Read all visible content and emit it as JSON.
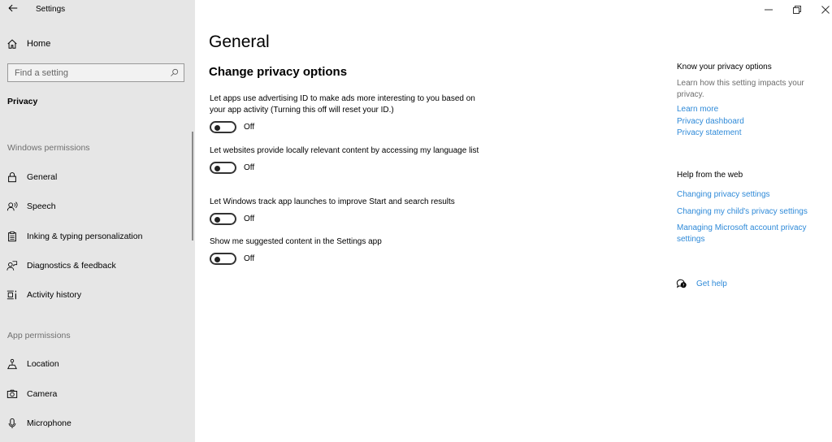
{
  "window": {
    "title": "Settings",
    "controls": {
      "minimize": "minimize-icon",
      "restore": "restore-icon",
      "close": "close-icon"
    }
  },
  "sidebar": {
    "home_label": "Home",
    "search_placeholder": "Find a setting",
    "current_section": "Privacy",
    "groups": [
      {
        "heading": "Windows permissions",
        "items": [
          {
            "label": "General",
            "icon": "lock-icon"
          },
          {
            "label": "Speech",
            "icon": "speech-icon"
          },
          {
            "label": "Inking & typing personalization",
            "icon": "clipboard-icon"
          },
          {
            "label": "Diagnostics & feedback",
            "icon": "feedback-icon"
          },
          {
            "label": "Activity history",
            "icon": "timeline-icon"
          }
        ]
      },
      {
        "heading": "App permissions",
        "items": [
          {
            "label": "Location",
            "icon": "location-icon"
          },
          {
            "label": "Camera",
            "icon": "camera-icon"
          },
          {
            "label": "Microphone",
            "icon": "microphone-icon"
          }
        ]
      }
    ]
  },
  "main": {
    "title": "General",
    "subtitle": "Change privacy options",
    "options": [
      {
        "description": "Let apps use advertising ID to make ads more interesting to you based on your app activity (Turning this off will reset your ID.)",
        "state": "Off",
        "on": false
      },
      {
        "description": "Let websites provide locally relevant content by accessing my language list",
        "state": "Off",
        "on": false
      },
      {
        "description": "Let Windows track app launches to improve Start and search results",
        "state": "Off",
        "on": false
      },
      {
        "description": "Show me suggested content in the Settings app",
        "state": "Off",
        "on": false
      }
    ]
  },
  "aside": {
    "know": {
      "heading": "Know your privacy options",
      "text": "Learn how this setting impacts your privacy.",
      "links": [
        "Learn more",
        "Privacy dashboard",
        "Privacy statement"
      ]
    },
    "help": {
      "heading": "Help from the web",
      "links": [
        "Changing privacy settings",
        "Changing my child's privacy settings",
        "Managing Microsoft account privacy settings"
      ]
    },
    "get_help_label": "Get help"
  },
  "colors": {
    "sidebar_bg": "#e6e6e6",
    "link": "#2f8ad8",
    "muted": "#707070"
  }
}
